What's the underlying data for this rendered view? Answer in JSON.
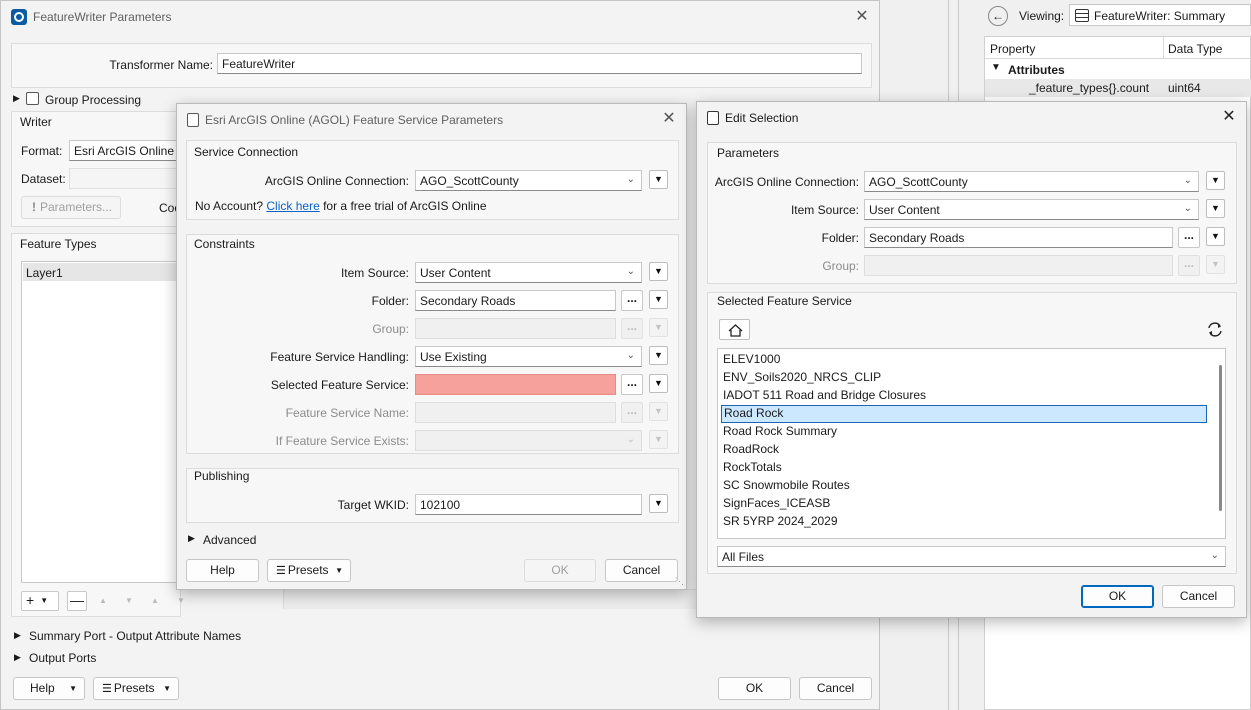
{
  "bg_panel": {
    "viewing_label": "Viewing:",
    "viewing_value": "FeatureWriter: Summary",
    "col_property": "Property",
    "col_datatype": "Data Type",
    "group_attributes": "Attributes",
    "row1_name": "_feature_types{}.count",
    "row1_type": "uint64"
  },
  "fw": {
    "title": "FeatureWriter Parameters",
    "transformer_name_label": "Transformer Name:",
    "transformer_name_value": "FeatureWriter",
    "group_processing": "Group Processing",
    "writer_group": "Writer",
    "format_label": "Format:",
    "format_value": "Esri ArcGIS Online (",
    "dataset_label": "Dataset:",
    "parameters_btn": "Parameters...",
    "coord_label": "Coo",
    "feature_types_group": "Feature Types",
    "layer1": "Layer1",
    "summary_port": "Summary Port - Output Attribute Names",
    "output_ports": "Output Ports",
    "help": "Help",
    "presets": "Presets",
    "ok": "OK",
    "cancel": "Cancel"
  },
  "agol": {
    "title": "Esri ArcGIS Online (AGOL) Feature Service Parameters",
    "service_connection": "Service Connection",
    "conn_label": "ArcGIS Online Connection:",
    "conn_value": "AGO_ScottCounty",
    "no_account": "No Account?",
    "click_here": "Click here",
    "trial_text": "for a free trial of ArcGIS Online",
    "constraints": "Constraints",
    "item_source_label": "Item Source:",
    "item_source_value": "User Content",
    "folder_label": "Folder:",
    "folder_value": "Secondary Roads",
    "group_label": "Group:",
    "fs_handling_label": "Feature Service Handling:",
    "fs_handling_value": "Use Existing",
    "selected_fs_label": "Selected Feature Service:",
    "fs_name_label": "Feature Service Name:",
    "fs_exists_label": "If Feature Service Exists:",
    "publishing": "Publishing",
    "wkid_label": "Target WKID:",
    "wkid_value": "102100",
    "advanced": "Advanced",
    "help": "Help",
    "presets": "Presets",
    "ok": "OK",
    "cancel": "Cancel"
  },
  "edit": {
    "title": "Edit Selection",
    "parameters": "Parameters",
    "conn_label": "ArcGIS Online Connection:",
    "conn_value": "AGO_ScottCounty",
    "item_source_label": "Item Source:",
    "item_source_value": "User Content",
    "folder_label": "Folder:",
    "folder_value": "Secondary Roads",
    "group_label": "Group:",
    "selected_fs": "Selected Feature Service",
    "items": [
      "ELEV1000",
      "ENV_Soils2020_NRCS_CLIP",
      "IADOT 511 Road and Bridge Closures",
      "Road Rock",
      "Road Rock Summary",
      "RoadRock",
      "RockTotals",
      "SC Snowmobile Routes",
      "SignFaces_ICEASB",
      "SR 5YRP 2024_2029"
    ],
    "selected_index": 3,
    "filter_value": "All Files",
    "ok": "OK",
    "cancel": "Cancel"
  }
}
